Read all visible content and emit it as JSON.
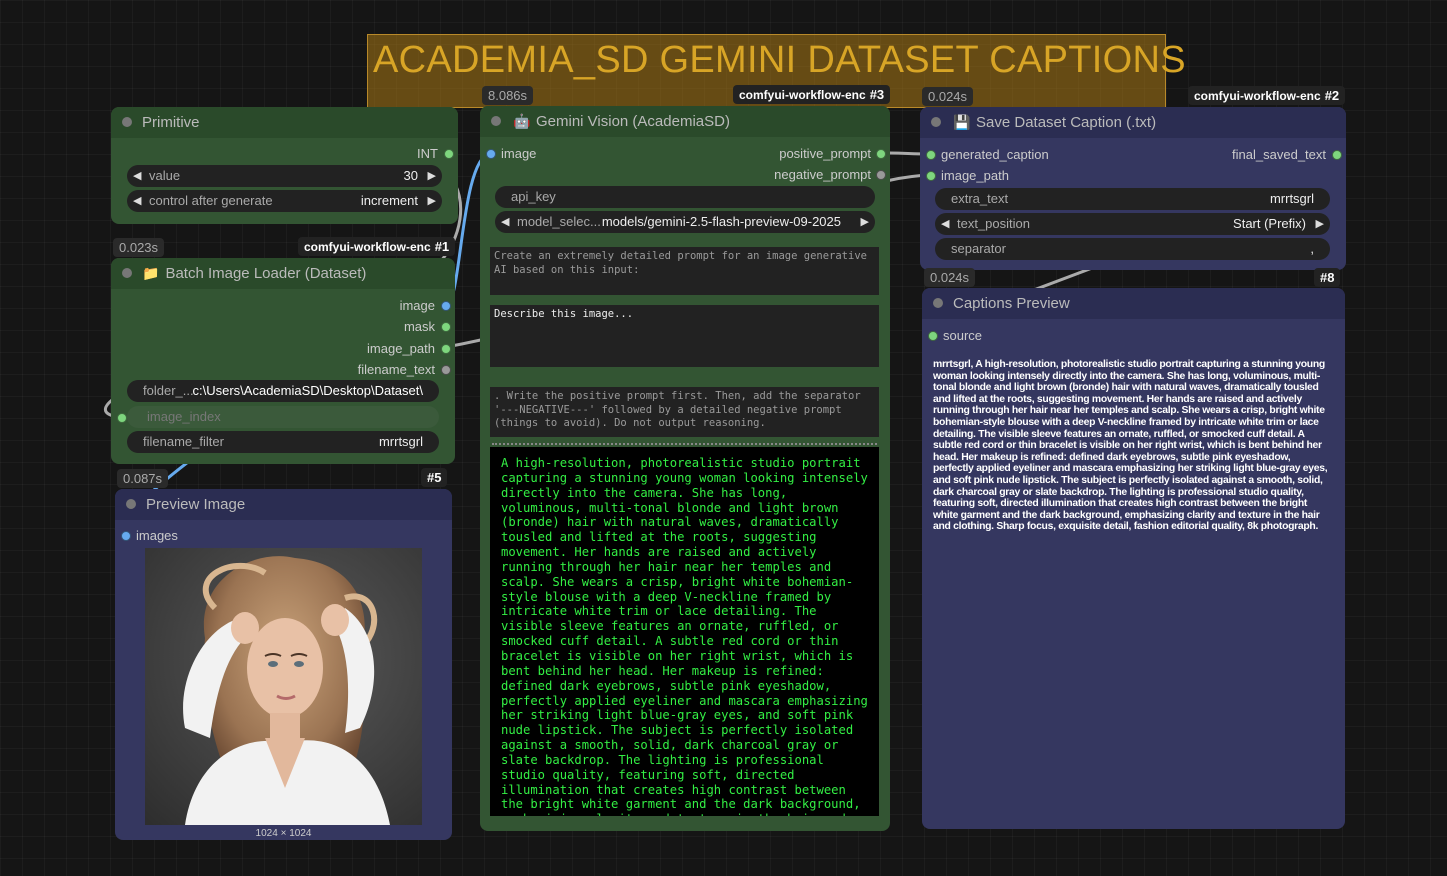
{
  "group": {
    "title": "ACADEMIA_SD GEMINI DATASET CAPTIONS"
  },
  "primitive": {
    "title": "Primitive",
    "output_type": "INT",
    "value_label": "value",
    "value": "30",
    "control_label": "control after generate",
    "control_value": "increment"
  },
  "gemini": {
    "time": "8.086s",
    "workflow": "comfyui-workflow-enc",
    "id": "#3",
    "title": "Gemini Vision (AcademiaSD)",
    "input_image": "image",
    "output_positive": "positive_prompt",
    "output_negative": "negative_prompt",
    "api_key_label": "api_key",
    "model_label": "model_selec...",
    "model_value": "models/gemini-2.5-flash-preview-09-2025",
    "prompt_prefix": "Create an extremely detailed prompt for an image generative AI based on this input:",
    "prompt_main": "Describe this image...",
    "prompt_suffix": ". Write the positive prompt first. Then, add the separator '---NEGATIVE---' followed by a detailed negative prompt (things to avoid). Do not output reasoning.",
    "output_text": "A high-resolution, photorealistic studio portrait capturing a stunning young woman looking intensely directly into the camera. She has long, voluminous, multi-tonal blonde and light brown (bronde) hair with natural waves, dramatically tousled and lifted at the roots, suggesting movement. Her hands are raised and actively running through her hair near her temples and scalp. She wears a crisp, bright white bohemian-style blouse with a deep V-neckline framed by intricate white trim or lace detailing. The visible sleeve features an ornate, ruffled, or smocked cuff detail. A subtle red cord or thin bracelet is visible on her right wrist, which is bent behind her head. Her makeup is refined: defined dark eyebrows, subtle pink eyeshadow, perfectly applied eyeliner and mascara emphasizing her striking light blue-gray eyes, and soft pink nude lipstick. The subject is perfectly isolated against a smooth, solid, dark charcoal gray or slate backdrop. The lighting is professional studio quality, featuring soft, directed illumination that creates high contrast between the bright white garment and the dark background, emphasizing clarity and texture in the hair and clothing. Sharp focus,"
  },
  "save": {
    "time": "0.024s",
    "workflow": "comfyui-workflow-enc",
    "id": "#2",
    "title": "Save Dataset Caption (.txt)",
    "input_caption": "generated_caption",
    "input_path": "image_path",
    "output": "final_saved_text",
    "extra_text_label": "extra_text",
    "extra_text_value": "mrrtsgrl",
    "text_position_label": "text_position",
    "text_position_value": "Start (Prefix)",
    "separator_label": "separator",
    "separator_value": ","
  },
  "loader": {
    "time": "0.023s",
    "workflow": "comfyui-workflow-enc",
    "id": "#1",
    "title": "Batch Image Loader (Dataset)",
    "out_image": "image",
    "out_mask": "mask",
    "out_path": "image_path",
    "out_filename": "filename_text",
    "folder_label": "folder_...",
    "folder_value": "c:\\Users\\AcademiaSD\\Desktop\\Dataset\\",
    "index_label": "image_index",
    "filter_label": "filename_filter",
    "filter_value": "mrrtsgrl"
  },
  "preview_image": {
    "time": "0.087s",
    "id": "#5",
    "title": "Preview Image",
    "input": "images",
    "dimensions": "1024 × 1024"
  },
  "captions_preview": {
    "time": "0.024s",
    "id": "#8",
    "title": "Captions Preview",
    "input": "source",
    "text": "mrrtsgrl, A high-resolution, photorealistic studio portrait capturing a stunning young woman looking intensely directly into the camera. She has long, voluminous, multi-tonal blonde and light brown (bronde) hair with natural waves, dramatically tousled and lifted at the roots, suggesting movement. Her hands are raised and actively running through her hair near her temples and scalp. She wears a crisp, bright white bohemian-style blouse with a deep V-neckline framed by intricate white trim or lace detailing. The visible sleeve features an ornate, ruffled, or smocked cuff detail. A subtle red cord or thin bracelet is visible on her right wrist, which is bent behind her head. Her makeup is refined: defined dark eyebrows, subtle pink eyeshadow, perfectly applied eyeliner and mascara emphasizing her striking light blue-gray eyes, and soft pink nude lipstick. The subject is perfectly isolated against a smooth, solid, dark charcoal gray or slate backdrop. The lighting is professional studio quality, featuring soft, directed illumination that creates high contrast between the bright white garment and the dark background, emphasizing clarity and texture in the hair and clothing. Sharp focus, exquisite detail, fashion editorial quality, 8k photograph."
  },
  "colors": {
    "green_node": "#335533",
    "blue_node": "#353760",
    "group": "#aa7814",
    "output_text": "#33ee44"
  }
}
